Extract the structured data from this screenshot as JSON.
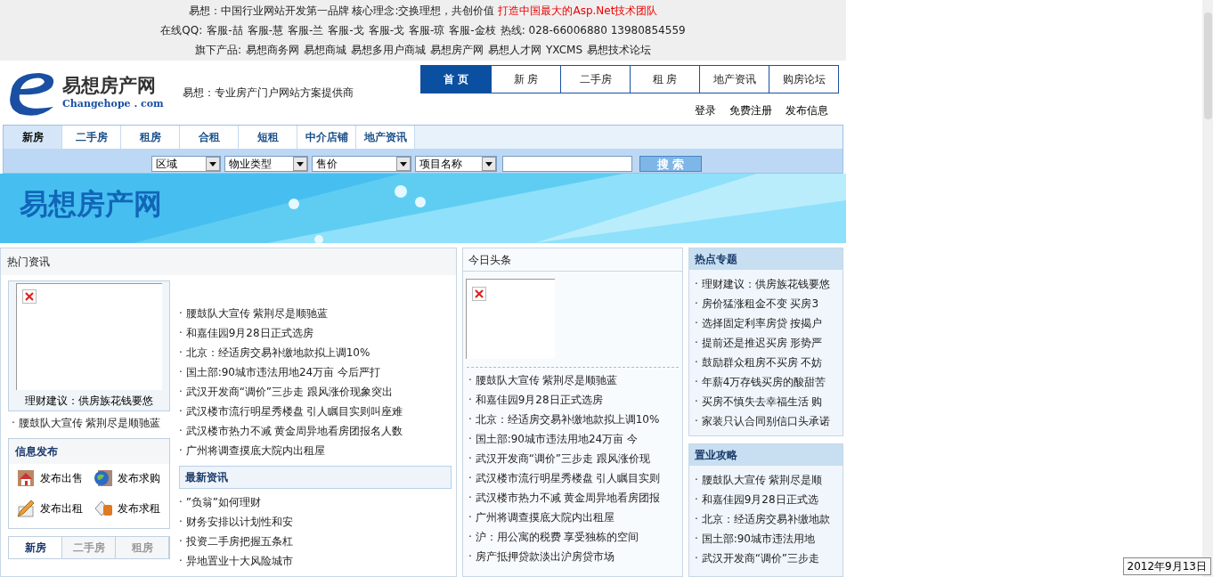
{
  "top_bar": {
    "line1": {
      "text": "易想：中国行业网站开发第一品牌 核心理念:交换理想，共创价值",
      "highlight": "打造中国最大的Asp.Net技术团队"
    },
    "line2": {
      "label": "在线QQ:",
      "links": [
        "客服-喆",
        "客服-慧",
        "客服-兰",
        "客服-戈",
        "客服-戈",
        "客服-琼",
        "客服-金枝"
      ],
      "hotline": "热线: 028-66006880 13980854559"
    },
    "line3": {
      "label": "旗下产品:",
      "links": [
        "易想商务网",
        "易想商城",
        "易想多用户商城",
        "易想房产网",
        "易想人才网",
        "YXCMS",
        "易想技术论坛"
      ]
    }
  },
  "logo": {
    "name": "易想房产网",
    "domain": "Changehope . com"
  },
  "slogan": "易想：专业房产门户网站方案提供商",
  "nav": [
    {
      "label": "首 页",
      "selected": true
    },
    {
      "label": "新 房",
      "selected": false
    },
    {
      "label": "二手房",
      "selected": false
    },
    {
      "label": "租 房",
      "selected": false
    },
    {
      "label": "地产资讯",
      "selected": false
    },
    {
      "label": "购房论坛",
      "selected": false
    }
  ],
  "user_links": [
    "登录",
    "免费注册",
    "发布信息"
  ],
  "search_tabs": [
    {
      "label": "新房",
      "selected": true
    },
    {
      "label": "二手房",
      "selected": false
    },
    {
      "label": "租房",
      "selected": false
    },
    {
      "label": "合租",
      "selected": false
    },
    {
      "label": "短租",
      "selected": false
    },
    {
      "label": "中介店铺",
      "selected": false
    },
    {
      "label": "地产资讯",
      "selected": false
    }
  ],
  "search_selects": [
    "区域",
    "物业类型",
    "售价",
    "项目名称"
  ],
  "search_button": "搜 索",
  "banner": {
    "title": "易想房产网"
  },
  "hot_news": {
    "title": "热门资讯",
    "image_caption": "理财建议：供房族花钱要悠",
    "left_item": "· 腰鼓队大宣传  紫荆尽是顺驰蓝",
    "items": [
      "· 腰鼓队大宣传  紫荆尽是顺驰蓝",
      "· 和嘉佳园9月28日正式选房",
      "· 北京：经适房交易补缴地款拟上调10%",
      "· 国土部:90城市违法用地24万亩  今后严打",
      "· 武汉开发商“调价”三步走  跟风涨价现象突出",
      "· 武汉楼市流行明星秀楼盘  引人瞩目实则叫座难",
      "· 武汉楼市热力不减  黄金周异地看房团报名人数",
      "· 广州将调查摸底大院内出租屋"
    ]
  },
  "info_publish": {
    "title": "信息发布",
    "actions": [
      {
        "kind": "sell",
        "label": "发布出售"
      },
      {
        "kind": "buy",
        "label": "发布求购"
      },
      {
        "kind": "rent",
        "label": "发布出租"
      },
      {
        "kind": "seek",
        "label": "发布求租"
      }
    ]
  },
  "left_tabs": [
    {
      "label": "新房",
      "selected": true
    },
    {
      "label": "二手房",
      "selected": false
    },
    {
      "label": "租房",
      "selected": false
    }
  ],
  "latest_news": {
    "title": "最新资讯",
    "items": [
      "· ”负翁”如何理财",
      "· 财务安排以计划性和安",
      "· 投资二手房把握五条杠",
      "· 异地置业十大风险城市"
    ]
  },
  "headlines": {
    "title": "今日头条",
    "items": [
      "· 腰鼓队大宣传  紫荆尽是顺驰蓝",
      "· 和嘉佳园9月28日正式选房",
      "· 北京：经适房交易补缴地款拟上调10%",
      "· 国土部:90城市违法用地24万亩  今",
      "· 武汉开发商“调价”三步走  跟风涨价现",
      "· 武汉楼市流行明星秀楼盘  引人瞩目实则",
      "· 武汉楼市热力不减  黄金周异地看房团报",
      "· 广州将调查摸底大院内出租屋",
      "· 沪：用公寓的税费  享受独栋的空间",
      "· 房产抵押贷款淡出沪房贷市场"
    ]
  },
  "hot_topics": {
    "title": "热点专题",
    "items": [
      "· 理财建议：供房族花钱要悠",
      "· 房价猛涨租金不变  买房3",
      "· 选择固定利率房贷  按揭户",
      "· 提前还是推迟买房  形势严",
      "· 鼓励群众租房不买房  不妨",
      "· 年薪4万存钱买房的酸甜苦",
      "· 买房不慎失去幸福生活  购",
      "· 家装只认合同别信口头承诺"
    ]
  },
  "buying_guide": {
    "title": "置业攻略",
    "items": [
      "· 腰鼓队大宣传  紫荆尽是顺",
      "· 和嘉佳园9月28日正式选",
      "· 北京：经适房交易补缴地款",
      "· 国土部:90城市违法用地",
      "· 武汉开发商“调价”三步走"
    ]
  },
  "clock_tooltip": "2012年9月13日"
}
